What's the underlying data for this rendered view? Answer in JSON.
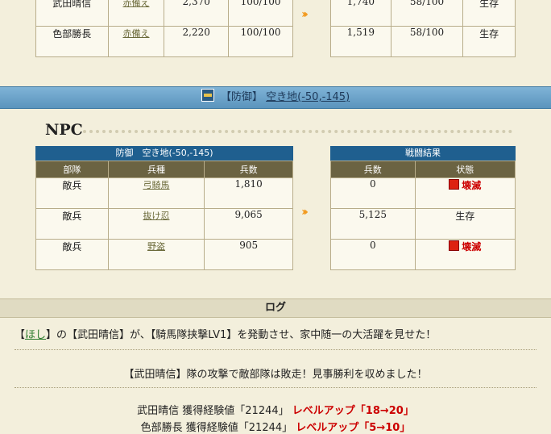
{
  "top_battle": {
    "left_rows": [
      {
        "name": "武田晴信",
        "unit": "赤備え",
        "troops": "2,370",
        "level": "100/100"
      },
      {
        "name": "色部勝長",
        "unit": "赤備え",
        "troops": "2,220",
        "level": "100/100"
      }
    ],
    "right_rows": [
      {
        "troops": "1,740",
        "level": "58/100",
        "status": "生存"
      },
      {
        "troops": "1,519",
        "level": "58/100",
        "status": "生存"
      }
    ]
  },
  "defense_band": {
    "prefix": "【防御】",
    "link": "空き地(-50,-145)"
  },
  "npc": {
    "title": "NPC",
    "left_caption": "防御　空き地(-50,-145)",
    "right_caption": "戦闘結果",
    "left_headers": [
      "部隊",
      "兵種",
      "兵数"
    ],
    "right_headers": [
      "兵数",
      "状態"
    ],
    "rows": [
      {
        "squad": "敵兵",
        "unit": "弓騎馬",
        "troops": "1,810",
        "after": "0",
        "status": "壊滅",
        "destroyed": true
      },
      {
        "squad": "敵兵",
        "unit": "抜け忍",
        "troops": "9,065",
        "after": "5,125",
        "status": "生存",
        "destroyed": false
      },
      {
        "squad": "敵兵",
        "unit": "野盗",
        "troops": "905",
        "after": "0",
        "status": "壊滅",
        "destroyed": true
      }
    ]
  },
  "log": {
    "title": "ログ",
    "line1": {
      "open": "【",
      "player": "ほし",
      "mid": "】の【武田晴信】が、【騎馬隊挟撃LV1】を発動させ、家中随一の大活躍を見せた！"
    },
    "line2": "【武田晴信】隊の攻撃で敵部隊は敗走！見事勝利を収めました！",
    "xp": [
      {
        "text": "武田晴信 獲得経験値「21244」",
        "level": "レベルアップ「18→20」"
      },
      {
        "text": "色部勝長 獲得経験値「21244」",
        "level": "レベルアップ「5→10」"
      }
    ]
  },
  "colors": {
    "band": "#6aa0c6",
    "caption": "#1f5f8f",
    "header": "#6b6342",
    "destroyed": "#cc0000",
    "arrow": "#f29a1f"
  },
  "icons": {
    "arrow": "triple-chevron-right-icon",
    "defense": "defense-flag-icon",
    "destroyed": "destroyed-icon"
  }
}
